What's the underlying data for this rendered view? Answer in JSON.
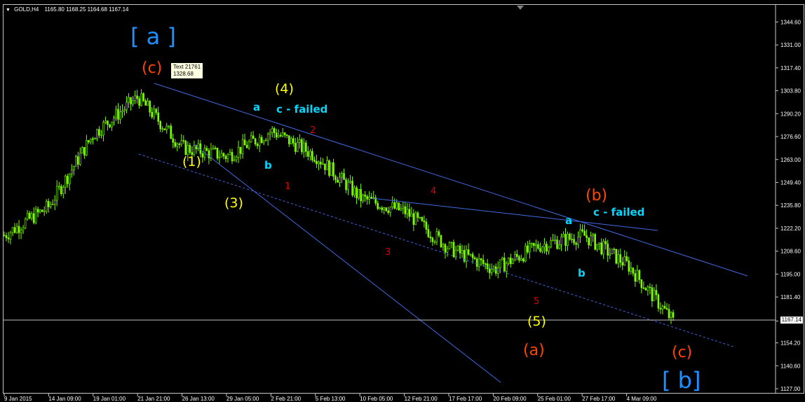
{
  "header": {
    "symbol": "GOLD,H4",
    "ohlc": "1165.80 1168.25 1164.68 1167.14"
  },
  "current_price_label": "1167.14",
  "tooltip": {
    "line1": "Text 21761",
    "line2": "1328.68"
  },
  "colors": {
    "background": "#000000",
    "candle": "#7cfc00",
    "trendline": "#4169e1",
    "cyan": "#00d8ff",
    "yellow": "#ffff00",
    "orange": "#ff4500",
    "red": "#dc0000",
    "blue_label": "#1e90ff"
  },
  "annotations": {
    "a_bracket": "[ a ]",
    "c1": "(c)",
    "one": "(1)",
    "three": "(3)",
    "four": "(4)",
    "five": "(5)",
    "a_paren": "(a)",
    "b_paren": "(b)",
    "c2": "(c)",
    "b_bracket": "[ b]",
    "cyan_a1": "a",
    "cyan_b1": "b",
    "cyan_cfailed1": "c - failed",
    "cyan_a2": "a",
    "cyan_b2": "b",
    "cyan_cfailed2": "c - failed",
    "red1": "1",
    "red2": "2",
    "red3": "3",
    "red4": "4",
    "red5": "5"
  },
  "chart_data": {
    "type": "line",
    "title": "GOLD,H4",
    "ylim": [
      1127.0,
      1351.0
    ],
    "y_ticks": [
      1344.6,
      1331.0,
      1317.4,
      1303.8,
      1290.2,
      1276.6,
      1263.0,
      1249.4,
      1235.8,
      1222.2,
      1208.6,
      1195.0,
      1181.4,
      1167.14,
      1154.2,
      1140.6,
      1127.0
    ],
    "x_tick_labels": [
      "9 Jan 2015",
      "14 Jan 09:00",
      "19 Jan 01:00",
      "21 Jan 21:00",
      "26 Jan 13:00",
      "29 Jan 05:00",
      "2 Feb 21:00",
      "5 Feb 13:00",
      "10 Feb 05:00",
      "12 Feb 21:00",
      "17 Feb 17:00",
      "20 Feb 09:00",
      "25 Feb 01:00",
      "27 Feb 17:00",
      "4 Mar 09:00"
    ],
    "series": [
      {
        "x": [
          "9 Jan 2015",
          "14 Jan 09:00",
          "19 Jan 01:00",
          "21 Jan 21:00",
          "26 Jan 13:00",
          "29 Jan 05:00",
          "2 Feb 21:00",
          "5 Feb 13:00",
          "10 Feb 05:00",
          "12 Feb 21:00",
          "17 Feb 17:00",
          "20 Feb 09:00",
          "25 Feb 01:00",
          "27 Feb 17:00",
          "4 Mar 09:00",
          "6 Mar"
        ],
        "values": [
          1218,
          1235,
          1278,
          1300,
          1270,
          1265,
          1280,
          1265,
          1240,
          1232,
          1210,
          1198,
          1212,
          1218,
          1200,
          1167
        ]
      }
    ]
  }
}
